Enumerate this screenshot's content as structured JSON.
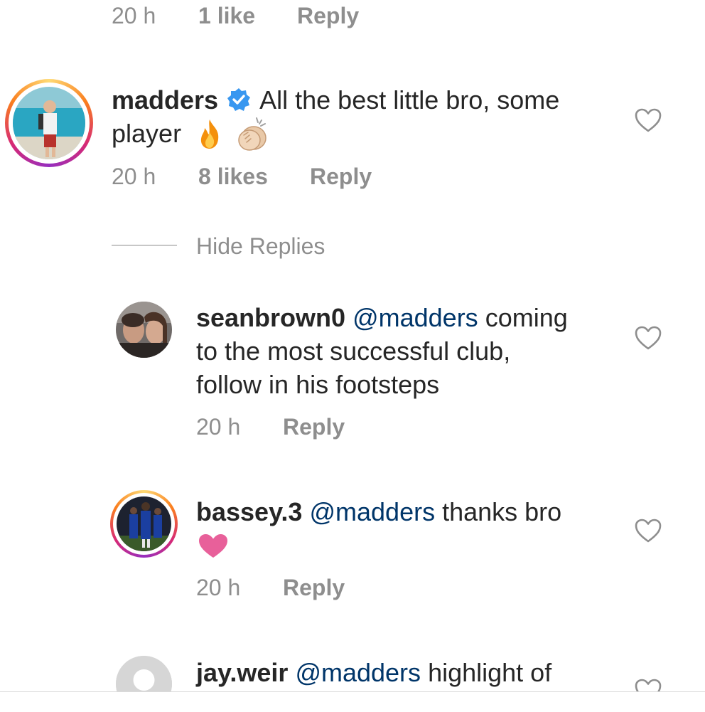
{
  "top_comment_meta": {
    "time": "20 h",
    "likes": "1 like",
    "reply": "Reply"
  },
  "comments": [
    {
      "username": "madders",
      "verified": true,
      "text": "All the best little bro, some",
      "text_line2": "player",
      "emojis": [
        "fire",
        "clapping-hands"
      ],
      "time": "20 h",
      "likes": "8 likes",
      "reply": "Reply"
    }
  ],
  "hide_replies_label": "Hide Replies",
  "replies": [
    {
      "username": "seanbrown0",
      "mention": "@madders",
      "text_line1": "coming",
      "text_line2": "to the most successful club,",
      "text_line3": "follow in his footsteps",
      "time": "20 h",
      "reply": "Reply"
    },
    {
      "username": "bassey.3",
      "mention": "@madders",
      "text_line1": "thanks bro",
      "emoji": "pink-heart",
      "time": "20 h",
      "reply": "Reply"
    },
    {
      "username": "jay.weir",
      "mention": "@madders",
      "text_line1": "highlight of"
    }
  ],
  "colors": {
    "mention": "#003569",
    "meta": "#8e8e8e",
    "verified": "#3897f0",
    "pink_heart": "#e8609a"
  }
}
